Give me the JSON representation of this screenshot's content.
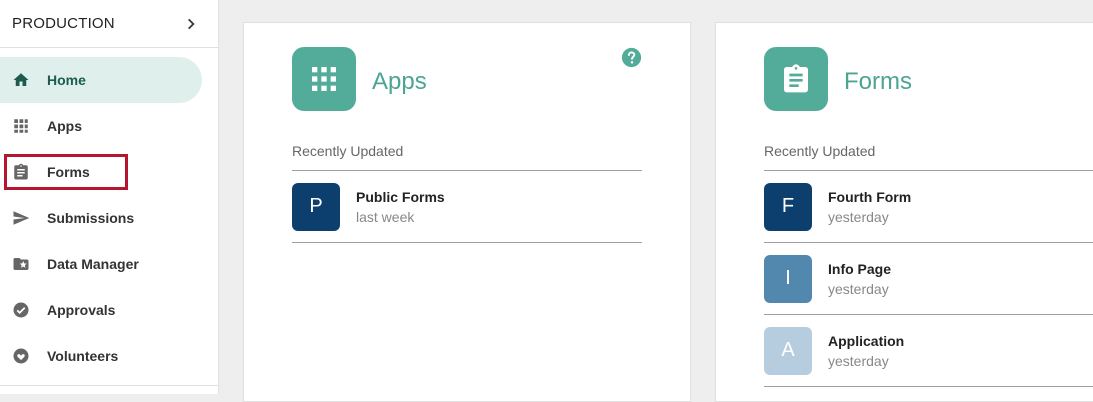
{
  "sidebar": {
    "environment": "PRODUCTION",
    "items": [
      {
        "label": "Home",
        "icon": "home-icon",
        "active": true
      },
      {
        "label": "Apps",
        "icon": "grid-icon",
        "active": false
      },
      {
        "label": "Forms",
        "icon": "clipboard-icon",
        "active": false
      },
      {
        "label": "Submissions",
        "icon": "send-icon",
        "active": false
      },
      {
        "label": "Data Manager",
        "icon": "folder-star-icon",
        "active": false
      },
      {
        "label": "Approvals",
        "icon": "check-circle-icon",
        "active": false
      },
      {
        "label": "Volunteers",
        "icon": "heart-hand-icon",
        "active": false
      }
    ]
  },
  "colors": {
    "accent": "#53ab9a",
    "active_bg": "#dff0ec",
    "highlight_border": "#b4152f"
  },
  "apps_card": {
    "title": "Apps",
    "section_label": "Recently Updated",
    "items": [
      {
        "initial": "P",
        "name": "Public Forms",
        "updated": "last week",
        "color": "#0d3f6e"
      }
    ]
  },
  "forms_card": {
    "title": "Forms",
    "section_label": "Recently Updated",
    "items": [
      {
        "initial": "F",
        "name": "Fourth Form",
        "updated": "yesterday",
        "color": "#0d3f6e"
      },
      {
        "initial": "I",
        "name": "Info Page",
        "updated": "yesterday",
        "color": "#5288ad"
      },
      {
        "initial": "A",
        "name": "Application",
        "updated": "yesterday",
        "color": "#b6cde0"
      }
    ]
  }
}
